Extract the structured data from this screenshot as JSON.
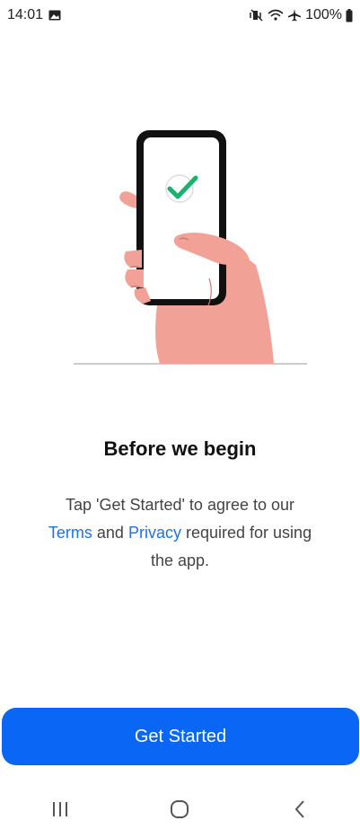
{
  "status_bar": {
    "time": "14:01",
    "battery": "100%",
    "icons": [
      "image-icon",
      "mute-vibrate-icon",
      "wifi-icon",
      "airplane-icon",
      "battery-icon"
    ]
  },
  "illustration": {
    "icon": "phone-in-hand-check-icon",
    "colors": {
      "skin": "#f2a197",
      "phone_frame": "#111111",
      "check": "#1bb26d",
      "ground_line": "#cccccc"
    }
  },
  "content": {
    "title": "Before we begin",
    "desc_part1": "Tap 'Get Started' to agree to our",
    "terms_link": "Terms",
    "desc_and": "and",
    "privacy_link": "Privacy",
    "desc_part2": "required for using the app."
  },
  "actions": {
    "get_started_label": "Get Started"
  },
  "nav": {
    "icons": [
      "recents-icon",
      "home-icon",
      "back-icon"
    ]
  },
  "colors": {
    "accent": "#0a66f5",
    "link": "#1a73e8"
  }
}
